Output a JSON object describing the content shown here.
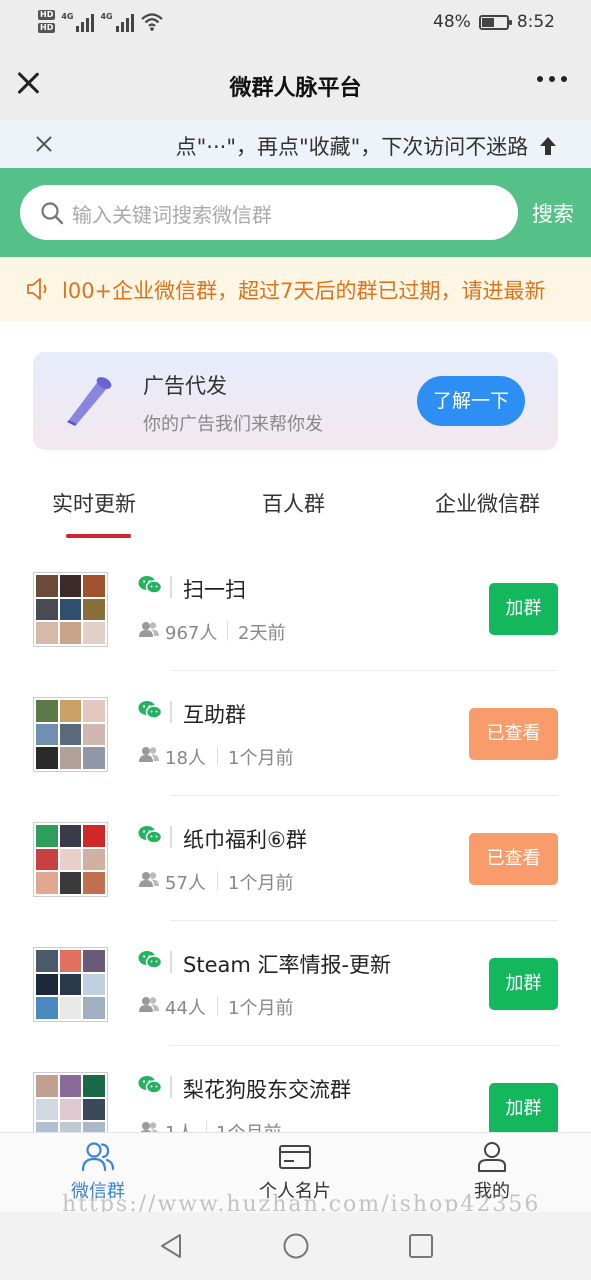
{
  "status_bar": {
    "hd_labels": [
      "HD",
      "HD"
    ],
    "signal_labels": [
      "4G",
      "4G"
    ],
    "battery_percent": "48%",
    "battery_level": 0.48,
    "time": "8:52"
  },
  "nav": {
    "title": "微群人脉平台"
  },
  "tip": {
    "text": "点\"···\"，再点\"收藏\"，下次访问不迷路"
  },
  "search": {
    "placeholder": "输入关键词搜索微信群",
    "button_label": "搜索"
  },
  "notice": {
    "text": "l00+企业微信群，超过7天后的群已过期，请进最新"
  },
  "ad": {
    "title": "广告代发",
    "subtitle": "你的广告我们来帮你发",
    "button_label": "了解一下"
  },
  "tabs": [
    {
      "label": "实时更新",
      "active": true
    },
    {
      "label": "百人群",
      "active": false
    },
    {
      "label": "企业微信群",
      "active": false
    }
  ],
  "groups": [
    {
      "name": "扫一扫",
      "members": "967人",
      "time": "2天前",
      "action": "加群",
      "action_type": "join",
      "avatar_colors": [
        "#6b4a3a",
        "#3d2a2a",
        "#a0522d",
        "#4a4a52",
        "#2f4f6f",
        "#8b6f3a",
        "#d8b8a8",
        "#c9a48a",
        "#e0d0c8"
      ]
    },
    {
      "name": "互助群",
      "members": "18人",
      "time": "1个月前",
      "action": "已查看",
      "action_type": "viewed",
      "avatar_colors": [
        "#5a7a4a",
        "#c8a068",
        "#e3c8c0",
        "#7090b0",
        "#5a6a7a",
        "#d0b8b0",
        "#2a2a2a",
        "#b0a098",
        "#9098a8"
      ]
    },
    {
      "name": "纸巾福利⑥群",
      "members": "57人",
      "time": "1个月前",
      "action": "已查看",
      "action_type": "viewed",
      "avatar_colors": [
        "#2e9e5a",
        "#3a3a4a",
        "#d02828",
        "#c84040",
        "#e8d0c8",
        "#d0b0a0",
        "#e0a890",
        "#3a3a3a",
        "#c07050"
      ]
    },
    {
      "name": "Steam 汇率情报-更新",
      "members": "44人",
      "time": "1个月前",
      "action": "加群",
      "action_type": "join",
      "avatar_colors": [
        "#4a5a6a",
        "#e07060",
        "#6a5a7a",
        "#1a2a3a",
        "#2a3a4a",
        "#c0d0e0",
        "#4a8ac0",
        "#e8e8e8",
        "#a0b0c0"
      ]
    },
    {
      "name": "梨花狗股东交流群",
      "members": "1人",
      "time": "1个月前",
      "action": "加群",
      "action_type": "join",
      "avatar_colors": [
        "#c0a090",
        "#8a6a9a",
        "#1a6a4a",
        "#d0d8e0",
        "#e0c8d0",
        "#3a4a5a",
        "#b0c0d0",
        "#c0c8d0",
        "#a8b8c8"
      ]
    }
  ],
  "tab_bar": [
    {
      "label": "微信群",
      "icon": "people-icon",
      "active": true
    },
    {
      "label": "个人名片",
      "icon": "card-icon",
      "active": false
    },
    {
      "label": "我的",
      "icon": "user-icon",
      "active": false
    }
  ],
  "watermark": "https://www.huzhan.com/ishop42356",
  "colors": {
    "header_green": "#55c189",
    "join_green": "#13b85d",
    "viewed_orange": "#f79c6a",
    "ad_blue": "#2d8ef3",
    "tab_underline": "#d0242e",
    "notice_orange": "#e0731a",
    "tabbar_active": "#3c84d8"
  }
}
